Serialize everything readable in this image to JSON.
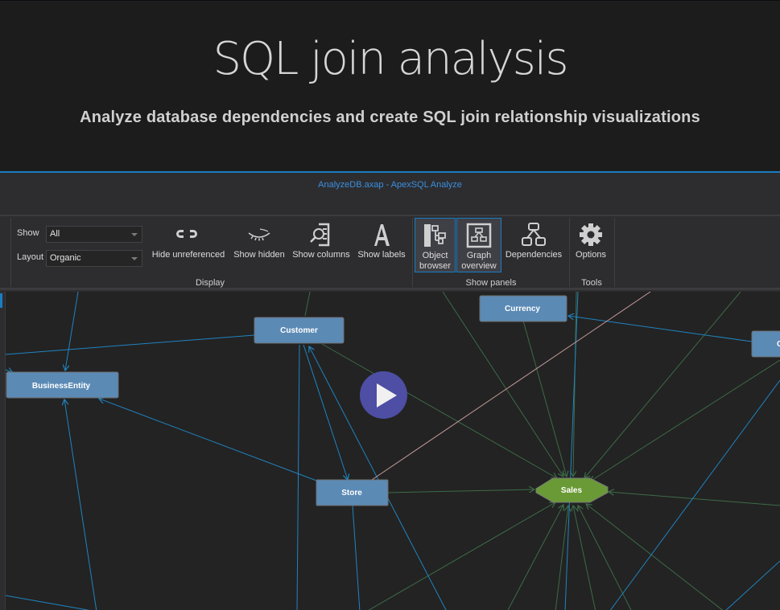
{
  "hero": {
    "title": "SQL join analysis",
    "subtitle": "Analyze database dependencies and create SQL join relationship visualizations"
  },
  "window": {
    "title": "AnalyzeDB.axap - ApexSQL Analyze"
  },
  "ribbon": {
    "display": {
      "group_label": "Display",
      "show_label": "Show",
      "show_value": "All",
      "layout_label": "Layout",
      "layout_value": "Organic",
      "buttons": [
        {
          "label": "Hide unreferenced",
          "icon": "hide-unreferenced-icon"
        },
        {
          "label": "Show hidden",
          "icon": "closed-eye-icon"
        },
        {
          "label": "Show columns",
          "icon": "search-columns-icon"
        },
        {
          "label": "Show labels",
          "icon": "letter-a-icon"
        }
      ]
    },
    "show_panels": {
      "group_label": "Show panels",
      "buttons": [
        {
          "label_line1": "Object",
          "label_line2": "browser",
          "icon": "object-browser-icon",
          "active": true
        },
        {
          "label_line1": "Graph",
          "label_line2": "overview",
          "icon": "graph-overview-icon",
          "active": true
        },
        {
          "label": "Dependencies",
          "icon": "dependencies-icon",
          "active": false
        }
      ]
    },
    "tools": {
      "group_label": "Tools",
      "buttons": [
        {
          "label": "Options",
          "icon": "gear-icon"
        }
      ]
    }
  },
  "graph": {
    "colors": {
      "table_node": "#5b8ab5",
      "hub_node": "#6a9a36",
      "edge_reference": "#1f84c0",
      "edge_join": "#3d6b48",
      "edge_special": "#c49a9a"
    },
    "nodes": [
      {
        "id": "customer",
        "label": "Customer",
        "type": "table"
      },
      {
        "id": "currency",
        "label": "Currency",
        "type": "table"
      },
      {
        "id": "businessentity",
        "label": "BusinessEntity",
        "type": "table"
      },
      {
        "id": "store",
        "label": "Store",
        "type": "table"
      },
      {
        "id": "sales",
        "label": "Sales",
        "type": "schema"
      },
      {
        "id": "offscreen",
        "label": "C",
        "type": "table"
      }
    ]
  },
  "video": {
    "play_icon": "play-icon"
  }
}
